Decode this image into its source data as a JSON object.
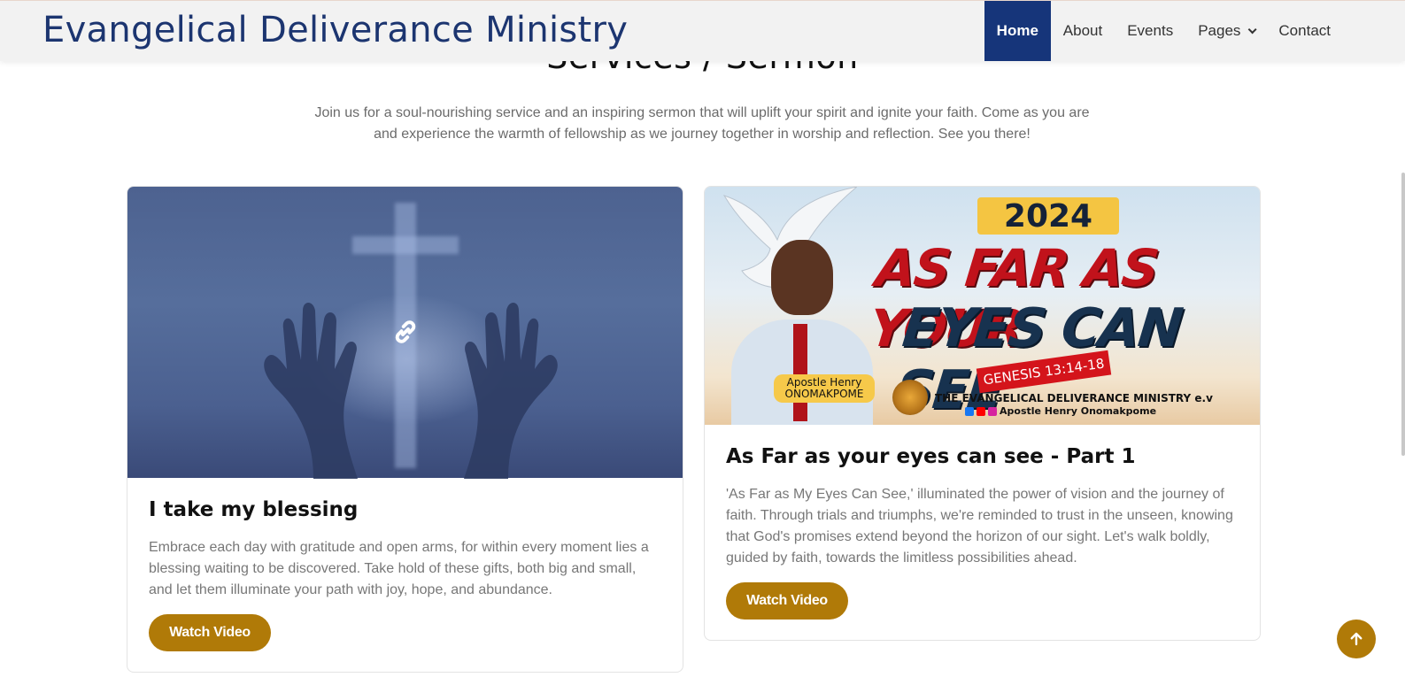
{
  "navbar": {
    "brand": "Evangelical Deliverance Ministry",
    "items": [
      {
        "label": "Home",
        "active": true
      },
      {
        "label": "About"
      },
      {
        "label": "Events"
      },
      {
        "label": "Pages",
        "has_dropdown": true
      },
      {
        "label": "Contact"
      }
    ]
  },
  "section": {
    "title": "Services / Sermon",
    "intro": "Join us for a soul-nourishing service and an inspiring sermon that will uplift your spirit and ignite your faith. Come as you are and experience the warmth of fellowship as we journey together in worship and reflection. See you there!"
  },
  "cards": [
    {
      "title": "I take my blessing",
      "text": "Embrace each day with gratitude and open arms, for within every moment lies a blessing waiting to be discovered. Take hold of these gifts, both big and small, and let them illuminate your path with joy, hope, and abundance.",
      "button": "Watch Video",
      "image_icon": "link-icon"
    },
    {
      "title": "As Far as your eyes can see - Part 1",
      "text": "'As Far as My Eyes Can See,' illuminated the power of vision and the journey of faith. Through trials and triumphs, we're reminded to trust in the unseen, knowing that God's promises extend beyond the horizon of our sight. Let's walk boldly, guided by faith, towards the limitless possibilities ahead.",
      "button": "Watch Video",
      "banner": {
        "year": "2024",
        "headline1": "AS FAR AS YOUR",
        "headline2": "EYES CAN SEE",
        "ribbon": "GENESIS 13:14-18",
        "name_line1": "Apostle Henry",
        "name_line2": "ONOMAKPOME",
        "org": "THE EVANGELICAL DELIVERANCE MINISTRY e.v",
        "social": "Apostle Henry Onomakpome"
      }
    }
  ],
  "colors": {
    "brand": "#1c3570",
    "nav_active": "#16357a",
    "accent": "#b07a08"
  },
  "scroll_top_icon": "arrow-up-icon"
}
